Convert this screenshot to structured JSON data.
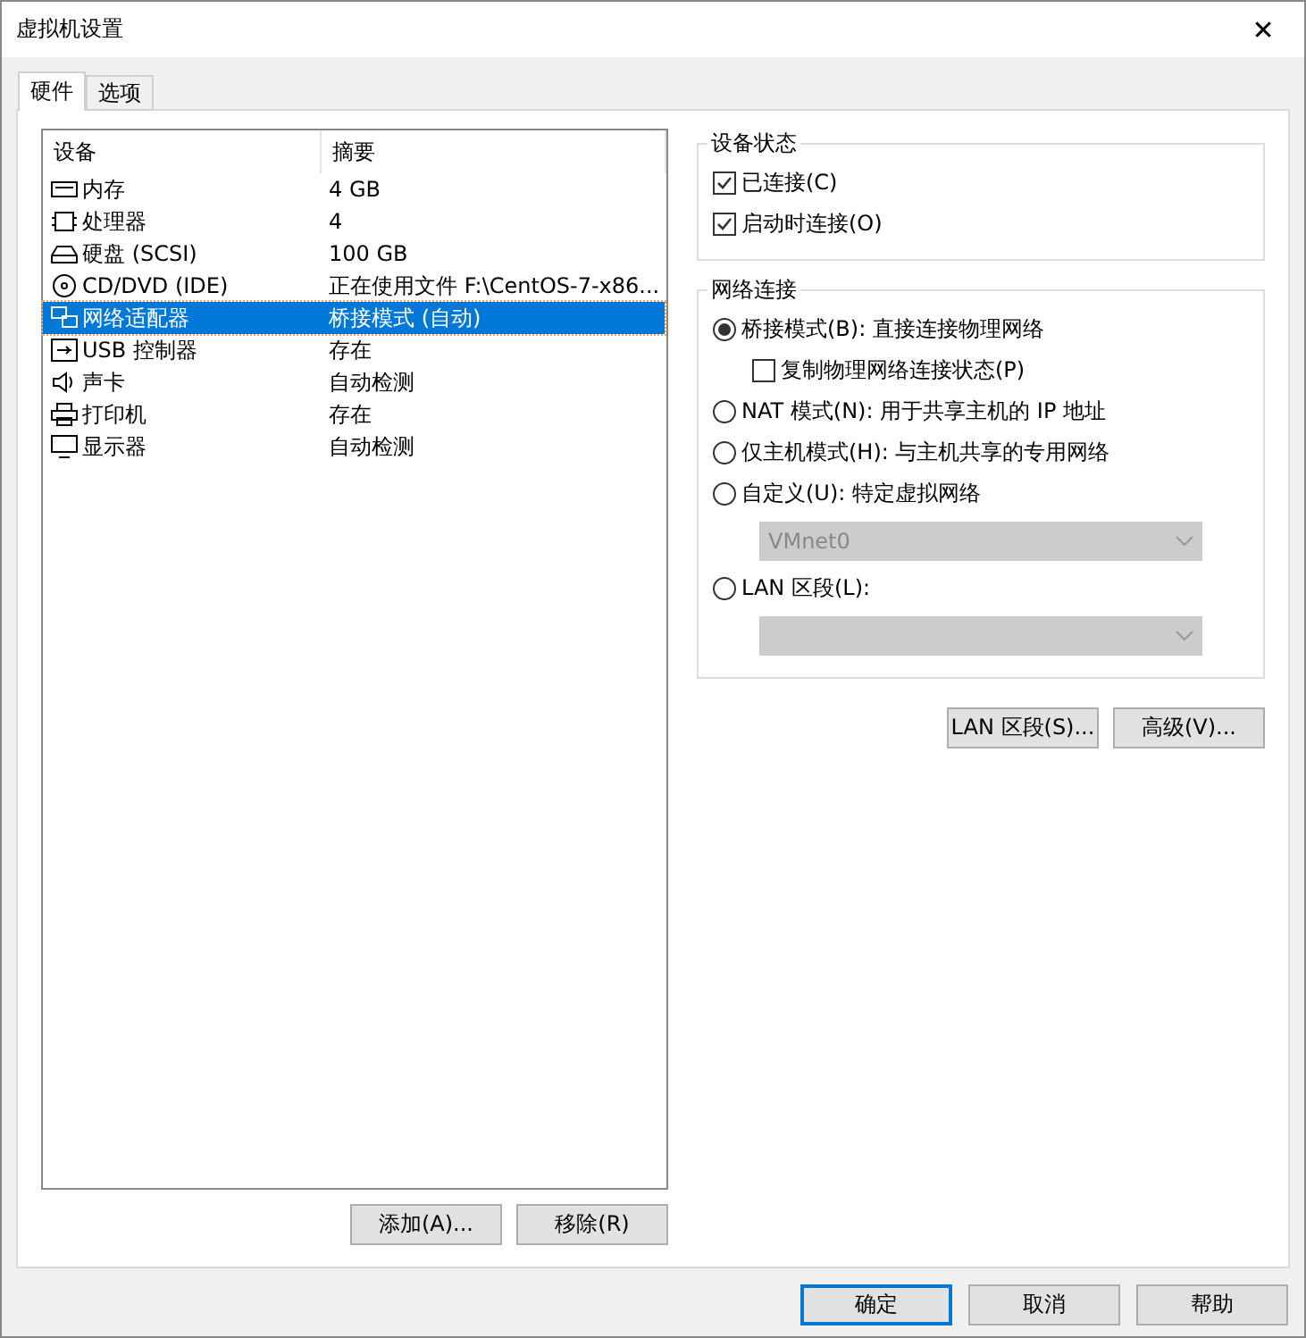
{
  "window": {
    "title": "虚拟机设置",
    "close": "✕"
  },
  "tabs": [
    {
      "label": "硬件",
      "selected": true
    },
    {
      "label": "选项",
      "selected": false
    }
  ],
  "devices": {
    "columns": [
      "设备",
      "摘要"
    ],
    "rows": [
      {
        "kind": "memory",
        "name": "内存",
        "summary": "4 GB",
        "selected": false
      },
      {
        "kind": "cpu",
        "name": "处理器",
        "summary": "4",
        "selected": false
      },
      {
        "kind": "disk",
        "name": "硬盘 (SCSI)",
        "summary": "100 GB",
        "selected": false
      },
      {
        "kind": "cd",
        "name": "CD/DVD (IDE)",
        "summary": "正在使用文件 F:\\CentOS-7-x86...",
        "selected": false
      },
      {
        "kind": "network",
        "name": "网络适配器",
        "summary": "桥接模式 (自动)",
        "selected": true
      },
      {
        "kind": "usb",
        "name": "USB 控制器",
        "summary": "存在",
        "selected": false
      },
      {
        "kind": "sound",
        "name": "声卡",
        "summary": "自动检测",
        "selected": false
      },
      {
        "kind": "printer",
        "name": "打印机",
        "summary": "存在",
        "selected": false
      },
      {
        "kind": "display",
        "name": "显示器",
        "summary": "自动检测",
        "selected": false
      }
    ]
  },
  "list_buttons": [
    "添加(A)...",
    "移除(R)"
  ],
  "device_status": {
    "title": "设备状态",
    "options": [
      {
        "label": "已连接(C)",
        "checked": true
      },
      {
        "label": "启动时连接(O)",
        "checked": true
      }
    ]
  },
  "network_connection": {
    "title": "网络连接",
    "items": [
      {
        "kind": "radio",
        "label": "桥接模式(B): 直接连接物理网络",
        "selected": true
      },
      {
        "kind": "checkbox",
        "label": "复制物理网络连接状态(P)",
        "checked": false
      },
      {
        "kind": "radio",
        "label": "NAT 模式(N): 用于共享主机的 IP 地址",
        "selected": false
      },
      {
        "kind": "radio",
        "label": "仅主机模式(H): 与主机共享的专用网络",
        "selected": false
      },
      {
        "kind": "radio",
        "label": "自定义(U): 特定虚拟网络",
        "selected": false
      },
      {
        "kind": "select",
        "value": "VMnet0",
        "disabled": true
      },
      {
        "kind": "radio",
        "label": "LAN 区段(L):",
        "selected": false
      },
      {
        "kind": "select",
        "disabled": true
      }
    ]
  },
  "network_buttons": [
    "LAN 区段(S)...",
    "高级(V)..."
  ],
  "dialog_buttons": [
    {
      "label": "确定",
      "default": true
    },
    {
      "label": "取消",
      "default": false
    },
    {
      "label": "帮助",
      "default": false
    }
  ]
}
